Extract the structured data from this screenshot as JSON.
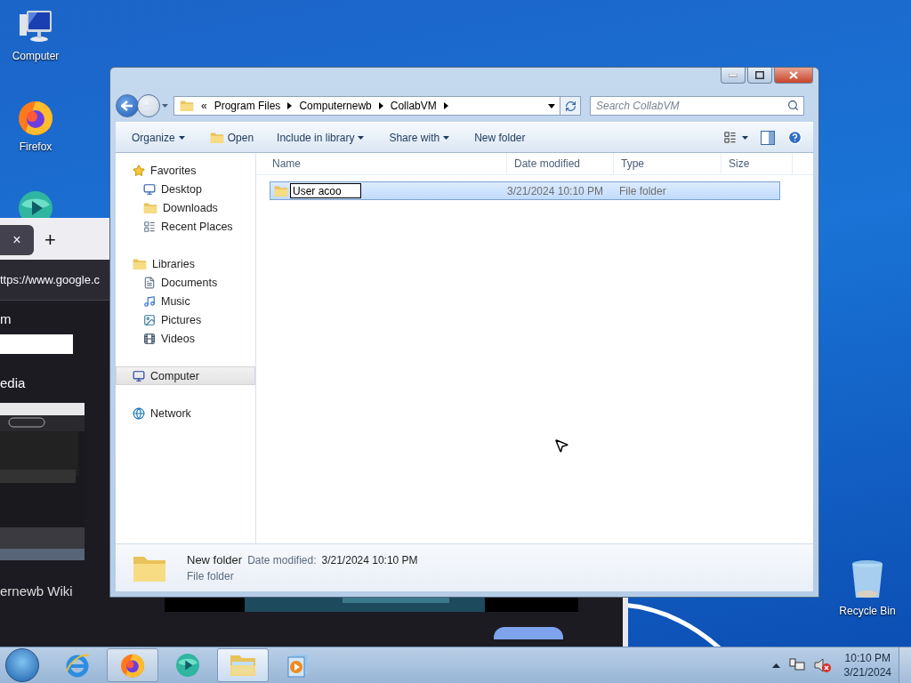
{
  "desktop_icons": [
    {
      "kind": "computer",
      "label": "Computer"
    },
    {
      "kind": "firefox",
      "label": "Firefox"
    },
    {
      "kind": "app"
    },
    {
      "kind": "recycle_bin",
      "label": "Recycle Bin"
    }
  ],
  "browser": {
    "tab_close": "×",
    "new_tab": "+",
    "url": "ttps://www.google.c",
    "texts": [
      "m",
      "edia",
      "ernewb Wiki"
    ]
  },
  "explorer": {
    "breadcrumb": {
      "overflow": "«",
      "items": [
        "Program Files",
        "Computernewb",
        "CollabVM"
      ]
    },
    "search": {
      "placeholder": "Search CollabVM"
    },
    "toolbar": [
      {
        "kind": "menu",
        "label": "Organize"
      },
      {
        "kind": "icon_button",
        "label": "Open"
      },
      {
        "kind": "menu",
        "label": "Include in library"
      },
      {
        "kind": "menu",
        "label": "Share with"
      },
      {
        "kind": "button",
        "label": "New folder"
      }
    ],
    "nav": [
      {
        "kind": "favorites",
        "label": "Favorites",
        "selected": false,
        "children": [
          {
            "kind": "desktop",
            "label": "Desktop",
            "selected": false
          },
          {
            "kind": "downloads",
            "label": "Downloads",
            "selected": false
          },
          {
            "kind": "recent",
            "label": "Recent Places",
            "selected": false
          }
        ]
      },
      {
        "kind": "libraries",
        "label": "Libraries",
        "selected": false,
        "children": [
          {
            "kind": "documents",
            "label": "Documents",
            "selected": false
          },
          {
            "kind": "music",
            "label": "Music",
            "selected": false
          },
          {
            "kind": "pictures",
            "label": "Pictures",
            "selected": false
          },
          {
            "kind": "videos",
            "label": "Videos",
            "selected": false
          }
        ]
      },
      {
        "kind": "computer",
        "label": "Computer",
        "selected": true
      },
      {
        "kind": "network",
        "label": "Network",
        "selected": false
      }
    ],
    "columns": [
      "Name",
      "Date modified",
      "Type",
      "Size"
    ],
    "rows": [
      {
        "name": "User acoo",
        "renaming": true,
        "selected": true,
        "date": "3/21/2024 10:10 PM",
        "type": "File folder"
      }
    ],
    "details": {
      "name": "New folder",
      "date_label": "Date modified:",
      "date": "3/21/2024 10:10 PM",
      "type": "File folder"
    }
  },
  "taskbar": {
    "apps": [
      {
        "kind": "ie",
        "running": false,
        "active": false
      },
      {
        "kind": "firefox",
        "running": true,
        "active": false
      },
      {
        "kind": "app",
        "running": false,
        "active": false
      },
      {
        "kind": "explorer",
        "running": true,
        "active": true
      },
      {
        "kind": "media",
        "running": false,
        "active": false
      }
    ],
    "clock": {
      "time": "10:10 PM",
      "date": "3/21/2024"
    }
  }
}
